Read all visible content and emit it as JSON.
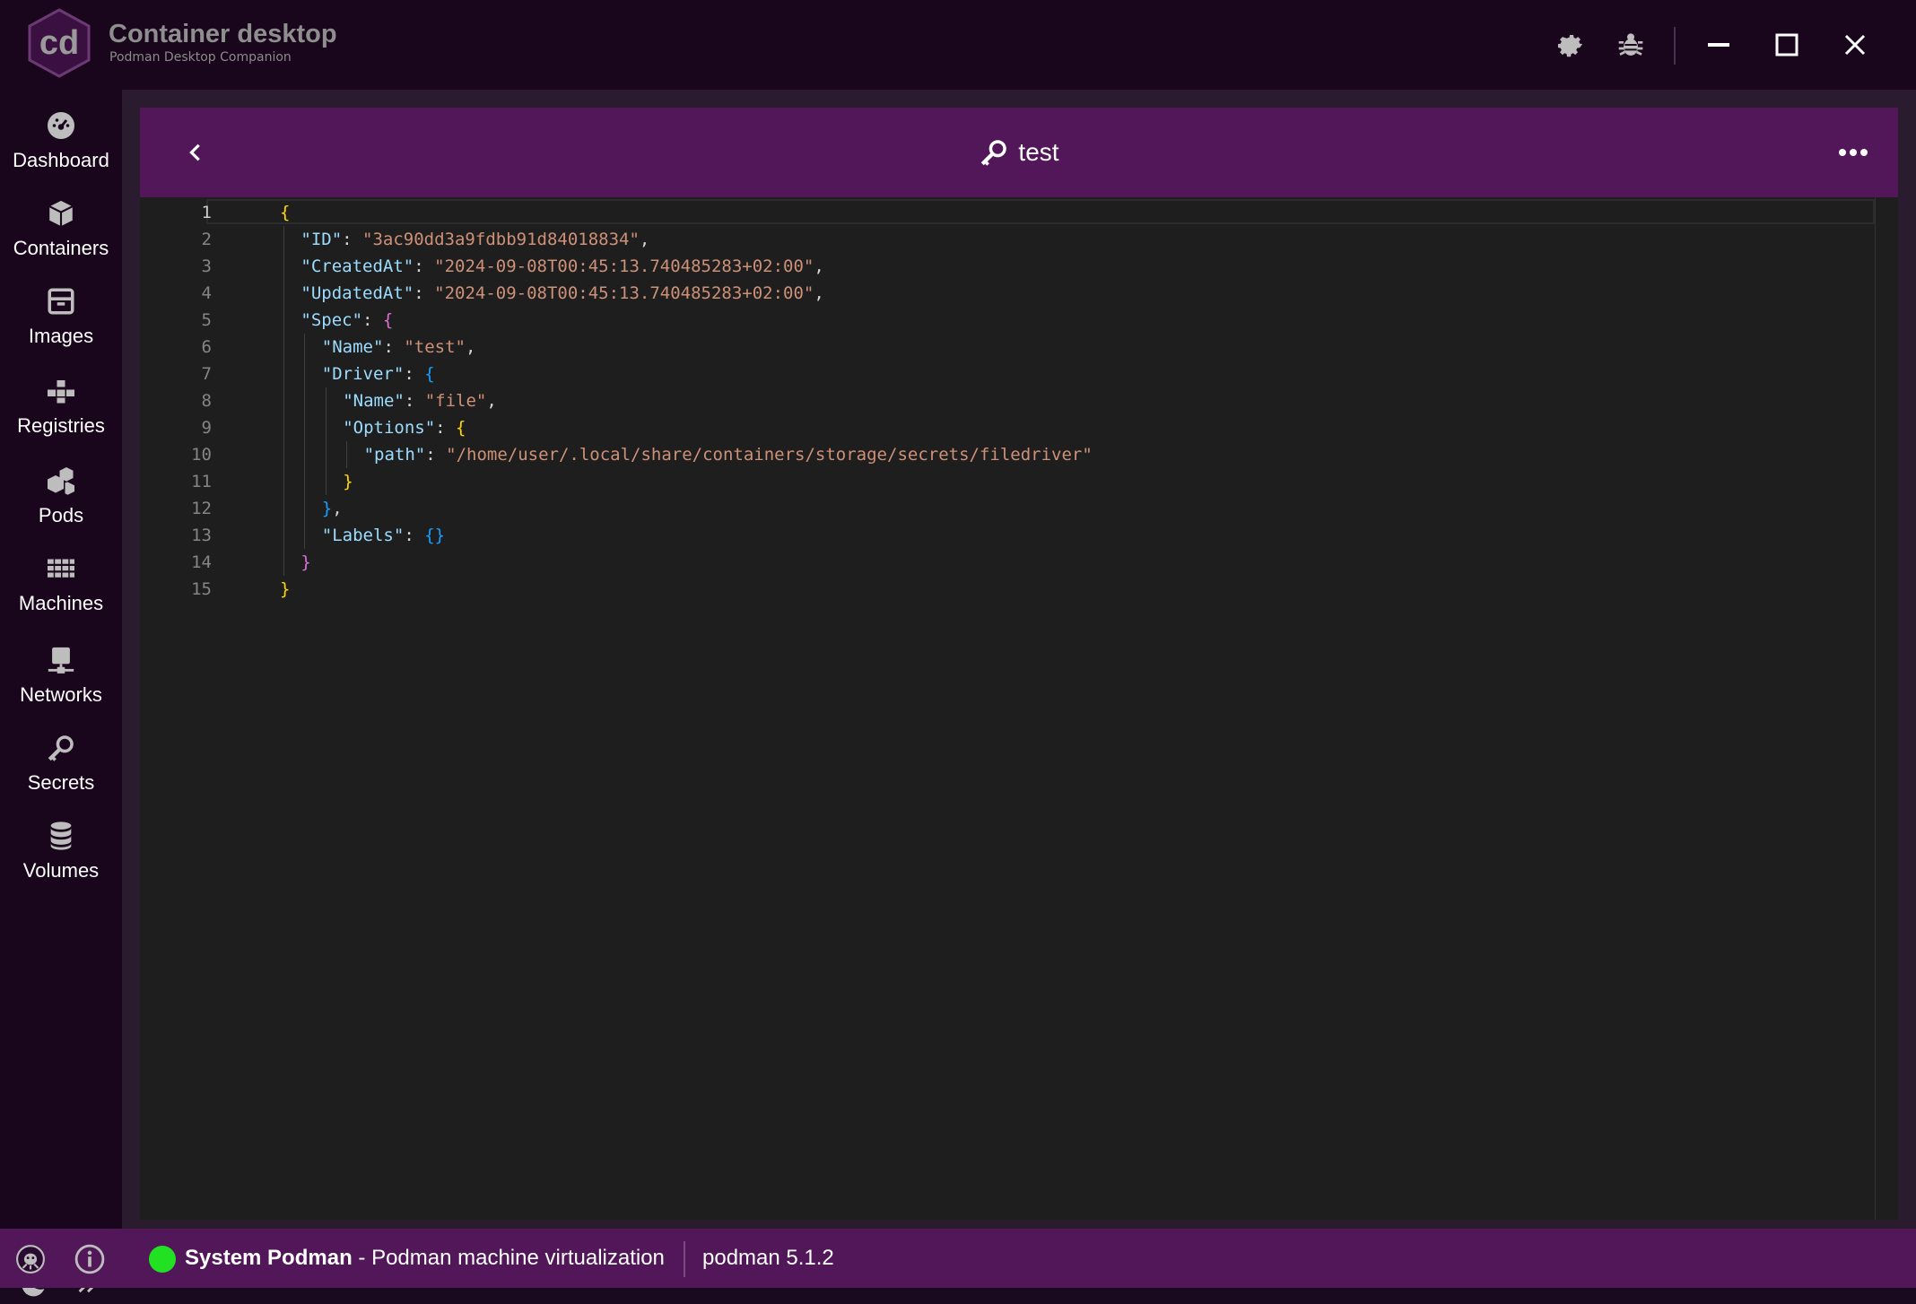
{
  "app": {
    "title": "Container desktop",
    "subtitle": "Podman Desktop Companion"
  },
  "titlebar": {
    "icons": [
      "gear-icon",
      "bug-icon",
      "minimize-icon",
      "maximize-icon",
      "close-icon"
    ]
  },
  "sidebar": {
    "items": [
      {
        "label": "Dashboard",
        "icon": "dashboard-icon"
      },
      {
        "label": "Containers",
        "icon": "cube-icon"
      },
      {
        "label": "Images",
        "icon": "box-icon"
      },
      {
        "label": "Registries",
        "icon": "registry-icon"
      },
      {
        "label": "Pods",
        "icon": "pods-icon"
      },
      {
        "label": "Machines",
        "icon": "grid-icon"
      },
      {
        "label": "Networks",
        "icon": "network-icon"
      },
      {
        "label": "Secrets",
        "icon": "key-icon"
      },
      {
        "label": "Volumes",
        "icon": "database-icon"
      }
    ],
    "bottom_icons": [
      "moon-icon",
      "expand-icon"
    ]
  },
  "panel": {
    "title": "test",
    "title_icon": "key-icon"
  },
  "editor": {
    "active_line": 1,
    "lines": [
      {
        "n": "1",
        "indent": 0,
        "tokens": [
          {
            "t": "{",
            "c": "b1"
          }
        ]
      },
      {
        "n": "2",
        "indent": 1,
        "tokens": [
          {
            "t": "\"ID\"",
            "c": "k"
          },
          {
            "t": ": ",
            "c": "p"
          },
          {
            "t": "\"3ac90dd3a9fdbb91d84018834\"",
            "c": "s"
          },
          {
            "t": ",",
            "c": "p"
          }
        ]
      },
      {
        "n": "3",
        "indent": 1,
        "tokens": [
          {
            "t": "\"CreatedAt\"",
            "c": "k"
          },
          {
            "t": ": ",
            "c": "p"
          },
          {
            "t": "\"2024-09-08T00:45:13.740485283+02:00\"",
            "c": "s"
          },
          {
            "t": ",",
            "c": "p"
          }
        ]
      },
      {
        "n": "4",
        "indent": 1,
        "tokens": [
          {
            "t": "\"UpdatedAt\"",
            "c": "k"
          },
          {
            "t": ": ",
            "c": "p"
          },
          {
            "t": "\"2024-09-08T00:45:13.740485283+02:00\"",
            "c": "s"
          },
          {
            "t": ",",
            "c": "p"
          }
        ]
      },
      {
        "n": "5",
        "indent": 1,
        "tokens": [
          {
            "t": "\"Spec\"",
            "c": "k"
          },
          {
            "t": ": ",
            "c": "p"
          },
          {
            "t": "{",
            "c": "b2"
          }
        ]
      },
      {
        "n": "6",
        "indent": 2,
        "tokens": [
          {
            "t": "\"Name\"",
            "c": "k"
          },
          {
            "t": ": ",
            "c": "p"
          },
          {
            "t": "\"test\"",
            "c": "s"
          },
          {
            "t": ",",
            "c": "p"
          }
        ]
      },
      {
        "n": "7",
        "indent": 2,
        "tokens": [
          {
            "t": "\"Driver\"",
            "c": "k"
          },
          {
            "t": ": ",
            "c": "p"
          },
          {
            "t": "{",
            "c": "b3"
          }
        ]
      },
      {
        "n": "8",
        "indent": 3,
        "tokens": [
          {
            "t": "\"Name\"",
            "c": "k"
          },
          {
            "t": ": ",
            "c": "p"
          },
          {
            "t": "\"file\"",
            "c": "s"
          },
          {
            "t": ",",
            "c": "p"
          }
        ]
      },
      {
        "n": "9",
        "indent": 3,
        "tokens": [
          {
            "t": "\"Options\"",
            "c": "k"
          },
          {
            "t": ": ",
            "c": "p"
          },
          {
            "t": "{",
            "c": "b1"
          }
        ]
      },
      {
        "n": "10",
        "indent": 4,
        "tokens": [
          {
            "t": "\"path\"",
            "c": "k"
          },
          {
            "t": ": ",
            "c": "p"
          },
          {
            "t": "\"/home/user/.local/share/containers/storage/secrets/filedriver\"",
            "c": "s"
          }
        ]
      },
      {
        "n": "11",
        "indent": 3,
        "tokens": [
          {
            "t": "}",
            "c": "b1"
          }
        ]
      },
      {
        "n": "12",
        "indent": 2,
        "tokens": [
          {
            "t": "}",
            "c": "b3"
          },
          {
            "t": ",",
            "c": "p"
          }
        ]
      },
      {
        "n": "13",
        "indent": 2,
        "tokens": [
          {
            "t": "\"Labels\"",
            "c": "k"
          },
          {
            "t": ": ",
            "c": "p"
          },
          {
            "t": "{}",
            "c": "b3"
          }
        ]
      },
      {
        "n": "14",
        "indent": 1,
        "tokens": [
          {
            "t": "}",
            "c": "b2"
          }
        ]
      },
      {
        "n": "15",
        "indent": 0,
        "tokens": [
          {
            "t": "}",
            "c": "b1"
          }
        ]
      }
    ]
  },
  "statusbar": {
    "engine_name": "System Podman",
    "engine_desc": " - Podman machine virtualization",
    "version": "podman 5.1.2",
    "status_color": "#22e022"
  },
  "colors": {
    "accent": "#511758",
    "background": "#1a061c",
    "editor_bg": "#1e1e1e"
  }
}
